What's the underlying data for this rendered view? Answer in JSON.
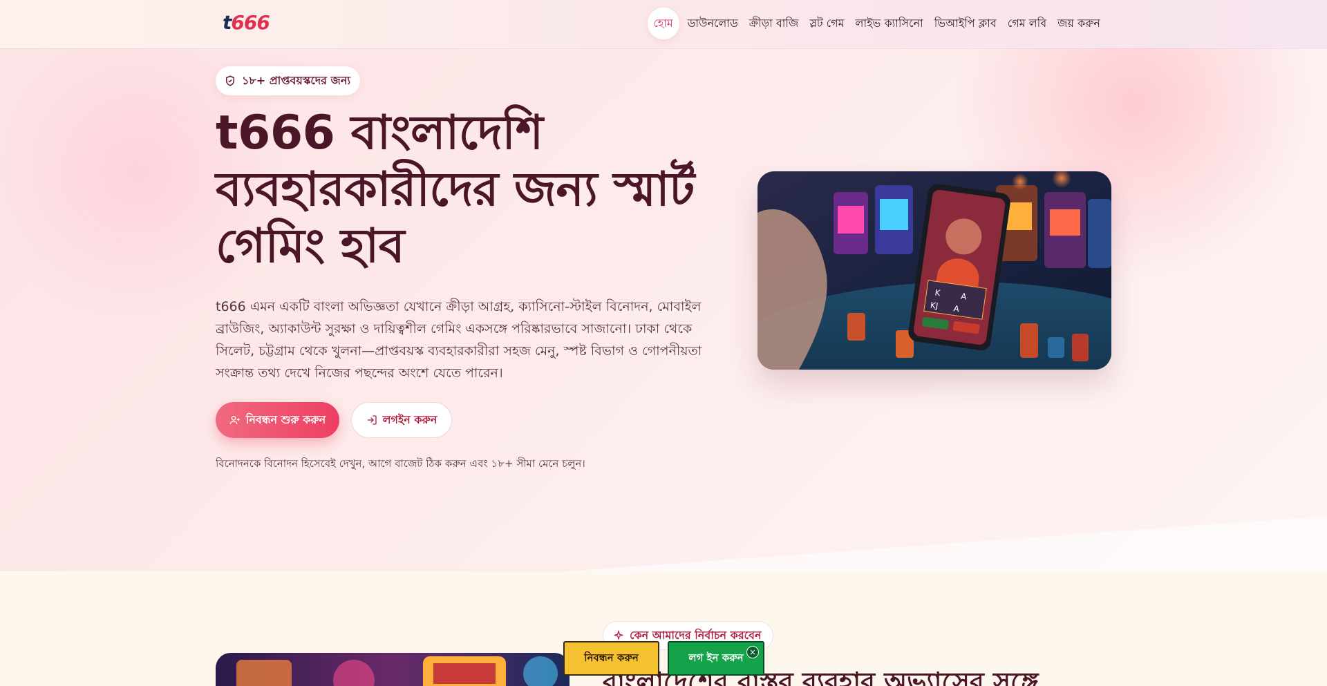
{
  "header": {
    "logo_text": "t",
    "logo_accent": "666",
    "nav": [
      "হোম",
      "ডাউনলোড",
      "ক্রীড়া বাজি",
      "স্লট গেম",
      "লাইভ ক্যাসিনো",
      "ভিআইপি ক্লাব",
      "গেম লবি",
      "জয় করুন"
    ]
  },
  "hero": {
    "badge": "১৮+ প্রাপ্তবয়স্কদের জন্য",
    "title": "t666 বাংলাদেশি ব্যবহারকারীদের জন্য স্মার্ট গেমিং হাব",
    "description": "t666 এমন একটি বাংলা অভিজ্ঞতা যেখানে ক্রীড়া আগ্রহ, ক্যাসিনো-স্টাইল বিনোদন, মোবাইল ব্রাউজিং, অ্যাকাউন্ট সুরক্ষা ও দায়িত্বশীল গেমিং একসঙ্গে পরিষ্কারভাবে সাজানো। ঢাকা থেকে সিলেট, চট্টগ্রাম থেকে খুলনা—প্রাপ্তবয়স্ক ব্যবহারকারীরা সহজ মেনু, স্পষ্ট বিভাগ ও গোপনীয়তা সংক্রান্ত তথ্য দেখে নিজের পছন্দের অংশে যেতে পারেন।",
    "primary_button": "নিবন্ধন শুরু করুন",
    "secondary_button": "লগইন করুন",
    "note": "বিনোদনকে বিনোদন হিসেবেই দেখুন, আগে বাজেট ঠিক করুন এবং ১৮+ সীমা মেনে চলুন।"
  },
  "section2": {
    "badge": "কেন আমাদের নির্বাচন করবেন",
    "title": "বাংলাদেশের বাস্তব ব্যবহার অভ্যাসের সঙ্গে"
  },
  "sticky": {
    "register": "নিবন্ধন করুন",
    "login": "লগ ইন করুন",
    "close": "×"
  },
  "colors": {
    "accent": "#ee3e62",
    "brand_dark": "#4a1628",
    "register_yellow": "#f5c331",
    "login_green": "#14a24a"
  }
}
